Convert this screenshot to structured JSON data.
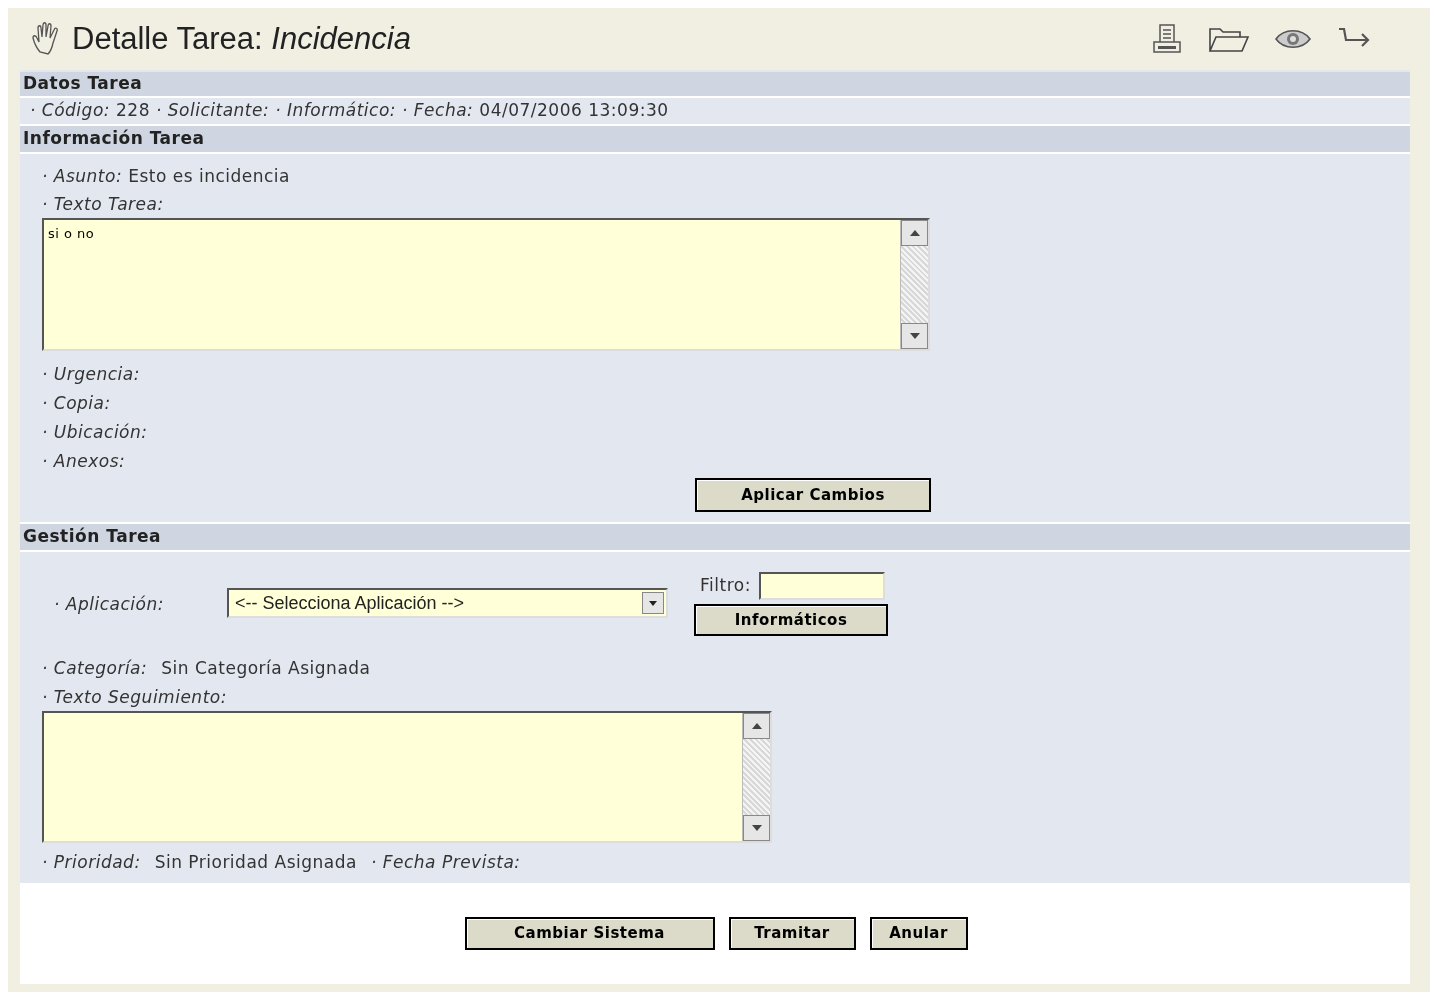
{
  "header": {
    "title": "Detalle Tarea:",
    "subtitle": "Incidencia"
  },
  "datos": {
    "title": "Datos Tarea",
    "items": [
      {
        "label": "· Código:",
        "value": "228"
      },
      {
        "label": "· Solicitante:",
        "value": ""
      },
      {
        "label": "· Informático:",
        "value": ""
      },
      {
        "label": "· Fecha:",
        "value": "04/07/2006 13:09:30"
      }
    ]
  },
  "informacion": {
    "title": "Información Tarea",
    "asunto": {
      "label": "· Asunto:",
      "value": "Esto es incidencia"
    },
    "texto_tarea": {
      "label": "· Texto Tarea:",
      "value": "si o no"
    },
    "fields": [
      {
        "label": "· Urgencia:"
      },
      {
        "label": "· Copia:"
      },
      {
        "label": "· Ubicación:"
      },
      {
        "label": "· Anexos:"
      }
    ],
    "apply_button": "Aplicar Cambios"
  },
  "gestion": {
    "title": "Gestión Tarea",
    "aplicacion": {
      "label": "· Aplicación:",
      "value": "<-- Selecciona Aplicación -->"
    },
    "filtro": {
      "label": "Filtro:"
    },
    "informaticos_button": "Informáticos",
    "categoria": {
      "label": "· Categoría:",
      "value": "Sin Categoría Asignada"
    },
    "texto_seguimiento": {
      "label": "· Texto Seguimiento:"
    },
    "prioridad": {
      "label": "· Prioridad:",
      "value": "Sin Prioridad Asignada"
    },
    "fecha_prevista": {
      "label": "· Fecha Prevista:"
    }
  },
  "buttons": [
    "Cambiar Sistema",
    "Tramitar",
    "Anular"
  ]
}
